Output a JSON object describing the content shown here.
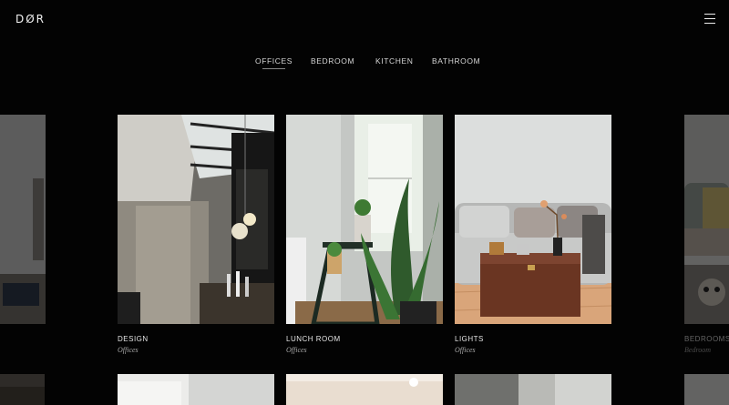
{
  "header": {
    "logo": "DØR",
    "menu_icon": "hamburger-menu-icon"
  },
  "tabs": [
    {
      "label": "OFFICES",
      "active": true
    },
    {
      "label": "BEDROOM",
      "active": false
    },
    {
      "label": "KITCHEN",
      "active": false
    },
    {
      "label": "BATHROOM",
      "active": false
    }
  ],
  "gallery": {
    "items": [
      {
        "title": "",
        "category": ""
      },
      {
        "title": "DESIGN",
        "category": "Offices"
      },
      {
        "title": "LUNCH ROOM",
        "category": "Offices"
      },
      {
        "title": "LIGHTS",
        "category": "Offices"
      },
      {
        "title": "BEDROOMS",
        "category": "Bedroom"
      }
    ]
  }
}
